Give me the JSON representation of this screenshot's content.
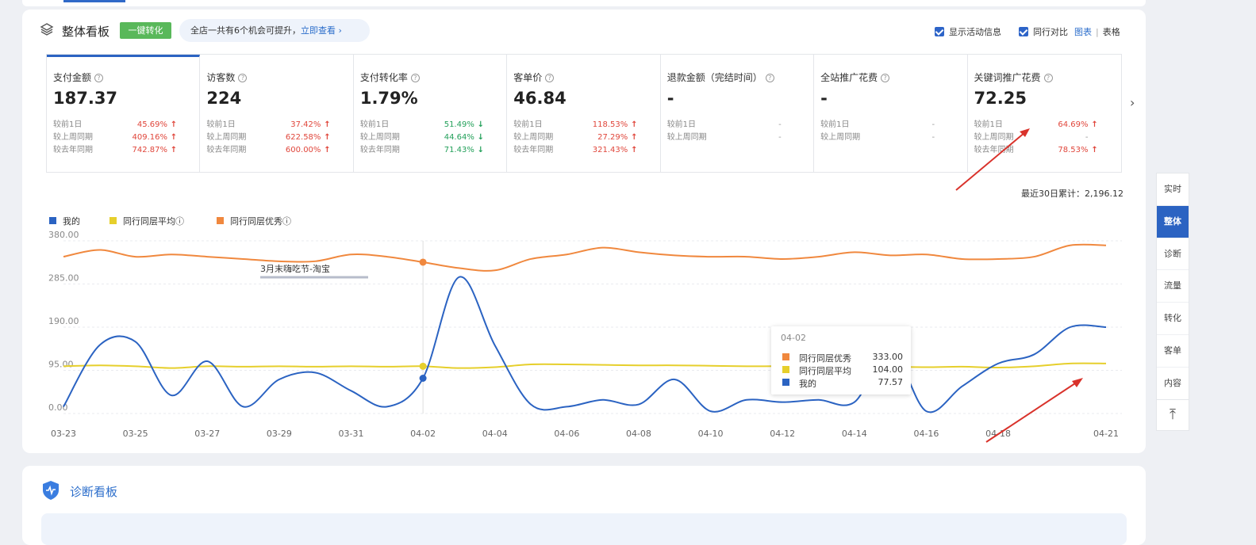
{
  "header": {
    "title": "整体看板",
    "convert_button": "一键转化",
    "tip_text": "全店一共有6个机会可提升，",
    "tip_link": "立即查看",
    "opt_activity": "显示活动信息",
    "opt_compare": "同行对比",
    "view_chart": "图表",
    "view_sep": "|",
    "view_table": "表格"
  },
  "metrics": [
    {
      "label": "支付金额",
      "value": "187.37",
      "rows": [
        {
          "k": "较前1日",
          "v": "45.69%",
          "dir": "up"
        },
        {
          "k": "较上周同期",
          "v": "409.16%",
          "dir": "up"
        },
        {
          "k": "较去年同期",
          "v": "742.87%",
          "dir": "up"
        }
      ]
    },
    {
      "label": "访客数",
      "value": "224",
      "rows": [
        {
          "k": "较前1日",
          "v": "37.42%",
          "dir": "up"
        },
        {
          "k": "较上周同期",
          "v": "622.58%",
          "dir": "up"
        },
        {
          "k": "较去年同期",
          "v": "600.00%",
          "dir": "up"
        }
      ]
    },
    {
      "label": "支付转化率",
      "value": "1.79%",
      "rows": [
        {
          "k": "较前1日",
          "v": "51.49%",
          "dir": "dn"
        },
        {
          "k": "较上周同期",
          "v": "44.64%",
          "dir": "dn"
        },
        {
          "k": "较去年同期",
          "v": "71.43%",
          "dir": "dn"
        }
      ]
    },
    {
      "label": "客单价",
      "value": "46.84",
      "rows": [
        {
          "k": "较前1日",
          "v": "118.53%",
          "dir": "up"
        },
        {
          "k": "较上周同期",
          "v": "27.29%",
          "dir": "up"
        },
        {
          "k": "较去年同期",
          "v": "321.43%",
          "dir": "up"
        }
      ]
    },
    {
      "label": "退款金额（完结时间）",
      "value": "-",
      "rows": [
        {
          "k": "较前1日",
          "v": "-",
          "dir": "nt"
        },
        {
          "k": "较上周同期",
          "v": "-",
          "dir": "nt"
        }
      ]
    },
    {
      "label": "全站推广花费",
      "value": "-",
      "rows": [
        {
          "k": "较前1日",
          "v": "-",
          "dir": "nt"
        },
        {
          "k": "较上周同期",
          "v": "-",
          "dir": "nt"
        }
      ]
    },
    {
      "label": "关键词推广花费",
      "value": "72.25",
      "rows": [
        {
          "k": "较前1日",
          "v": "64.69%",
          "dir": "up"
        },
        {
          "k": "较上周同期",
          "v": "-",
          "dir": "nt"
        },
        {
          "k": "较去年同期",
          "v": "78.53%",
          "dir": "up"
        }
      ]
    }
  ],
  "total_text": "最近30日累计：2,196.12",
  "sidenav": [
    "实时",
    "整体",
    "诊断",
    "流量",
    "转化",
    "客单",
    "内容"
  ],
  "sidenav_active": 1,
  "diag_title": "诊断看板",
  "tooltip": {
    "date": "04-02",
    "rows": [
      {
        "name": "同行同层优秀",
        "value": "333.00",
        "color": "#f0883e"
      },
      {
        "name": "同行同层平均",
        "value": "104.00",
        "color": "#e6cf2c"
      },
      {
        "name": "我的",
        "value": "77.57",
        "color": "#2b63c2"
      }
    ]
  },
  "event_label": "3月末嗨吃节-淘宝",
  "colors": {
    "mine": "#2b63c2",
    "avg": "#e6cf2c",
    "best": "#f0883e",
    "up": "#e0463b",
    "down": "#23a05a"
  },
  "chart_data": {
    "type": "line",
    "x": [
      "03-23",
      "03-24",
      "03-25",
      "03-26",
      "03-27",
      "03-28",
      "03-29",
      "03-30",
      "03-31",
      "04-01",
      "04-02",
      "04-03",
      "04-04",
      "04-05",
      "04-06",
      "04-07",
      "04-08",
      "04-09",
      "04-10",
      "04-11",
      "04-12",
      "04-13",
      "04-14",
      "04-15",
      "04-16",
      "04-17",
      "04-18",
      "04-19",
      "04-20",
      "04-21"
    ],
    "x_tick_labels": [
      "03-23",
      "03-25",
      "03-27",
      "03-29",
      "03-31",
      "04-02",
      "04-04",
      "04-06",
      "04-08",
      "04-10",
      "04-12",
      "04-14",
      "04-16",
      "04-18",
      "04-21"
    ],
    "y_ticks": [
      "0.00",
      "95.00",
      "190.00",
      "285.00",
      "380.00"
    ],
    "ylim": [
      0,
      380
    ],
    "legend": [
      {
        "name": "我的",
        "color": "#2b63c2"
      },
      {
        "name": "同行同层平均",
        "color": "#e6cf2c",
        "help": true
      },
      {
        "name": "同行同层优秀",
        "color": "#f0883e",
        "help": true
      }
    ],
    "series": [
      {
        "name": "我的",
        "values": [
          15,
          150,
          158,
          40,
          115,
          15,
          75,
          90,
          50,
          15,
          77.57,
          300,
          150,
          20,
          15,
          30,
          20,
          75,
          5,
          30,
          25,
          30,
          25,
          140,
          5,
          60,
          110,
          130,
          190,
          190
        ]
      },
      {
        "name": "同行同层平均",
        "values": [
          104,
          106,
          104,
          100,
          104,
          103,
          104,
          103,
          104,
          103,
          104,
          100,
          102,
          108,
          108,
          107,
          106,
          106,
          105,
          104,
          104,
          103,
          104,
          103,
          102,
          103,
          101,
          104,
          110,
          110
        ]
      },
      {
        "name": "同行同层优秀",
        "values": [
          345,
          360,
          345,
          350,
          345,
          340,
          335,
          335,
          350,
          345,
          333,
          320,
          315,
          340,
          350,
          365,
          355,
          348,
          345,
          345,
          340,
          345,
          355,
          348,
          350,
          340,
          340,
          345,
          370,
          370
        ]
      }
    ]
  }
}
